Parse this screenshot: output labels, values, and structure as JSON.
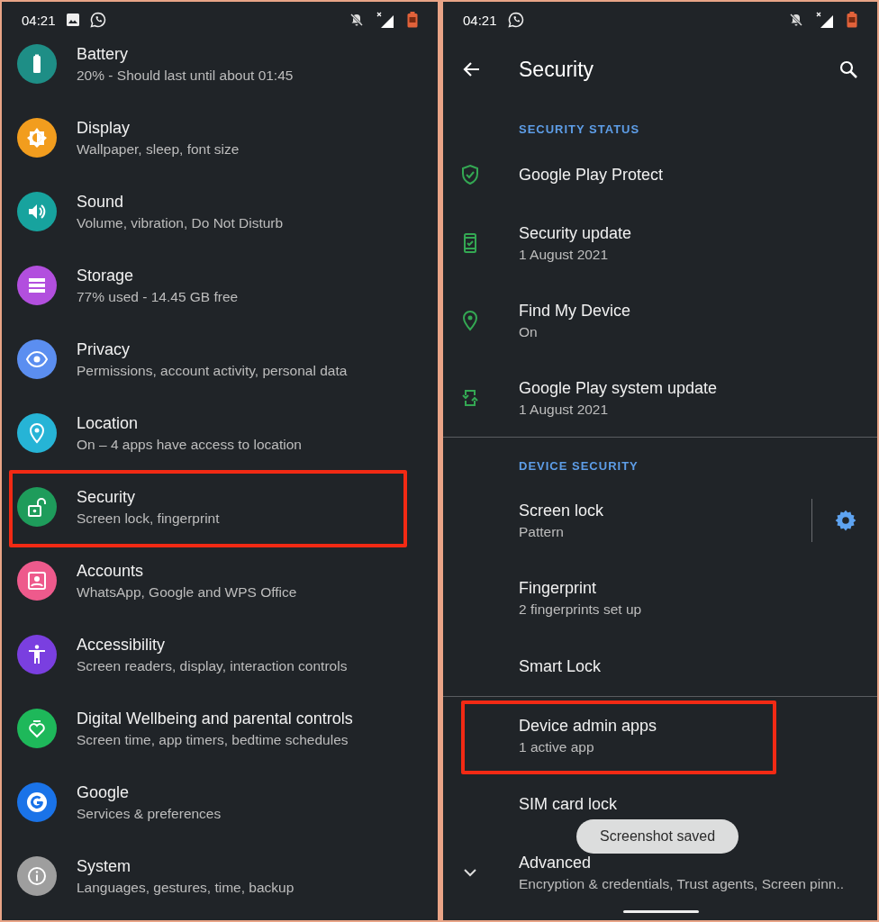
{
  "left_screen": {
    "status_bar": {
      "time": "04:21"
    },
    "settings": [
      {
        "title": "Battery",
        "subtitle": "20% - Should last until about 01:45",
        "color": "#1e8e86",
        "highlighted": false
      },
      {
        "title": "Display",
        "subtitle": "Wallpaper, sleep, font size",
        "color": "#f29d1e",
        "highlighted": false
      },
      {
        "title": "Sound",
        "subtitle": "Volume, vibration, Do Not Disturb",
        "color": "#17a39e",
        "highlighted": false
      },
      {
        "title": "Storage",
        "subtitle": "77% used - 14.45 GB free",
        "color": "#b24fde",
        "highlighted": false
      },
      {
        "title": "Privacy",
        "subtitle": "Permissions, account activity, personal data",
        "color": "#5b8ef0",
        "highlighted": false
      },
      {
        "title": "Location",
        "subtitle": "On – 4 apps have access to location",
        "color": "#26b4d6",
        "highlighted": false
      },
      {
        "title": "Security",
        "subtitle": "Screen lock, fingerprint",
        "color": "#1e9c5b",
        "highlighted": true
      },
      {
        "title": "Accounts",
        "subtitle": "WhatsApp, Google and WPS Office",
        "color": "#ee5a8c",
        "highlighted": false
      },
      {
        "title": "Accessibility",
        "subtitle": "Screen readers, display, interaction controls",
        "color": "#7a3fe0",
        "highlighted": false
      },
      {
        "title": "Digital Wellbeing and parental controls",
        "subtitle": "Screen time, app timers, bedtime schedules",
        "color": "#1eb85a",
        "highlighted": false
      },
      {
        "title": "Google",
        "subtitle": "Services & preferences",
        "color": "#1a73e8",
        "highlighted": false
      },
      {
        "title": "System",
        "subtitle": "Languages, gestures, time, backup",
        "color": "#9e9e9e",
        "highlighted": false
      }
    ]
  },
  "right_screen": {
    "status_bar": {
      "time": "04:21"
    },
    "app_bar": {
      "title": "Security"
    },
    "sections": [
      {
        "header": "SECURITY STATUS",
        "items": [
          {
            "title": "Google Play Protect",
            "highlighted": false
          },
          {
            "title": "Security update",
            "subtitle": "1 August 2021",
            "highlighted": false
          },
          {
            "title": "Find My Device",
            "subtitle": "On",
            "highlighted": false
          },
          {
            "title": "Google Play system update",
            "subtitle": "1 August 2021",
            "highlighted": false
          }
        ]
      },
      {
        "header": "DEVICE SECURITY",
        "items": [
          {
            "title": "Screen lock",
            "subtitle": "Pattern",
            "settings_button": true,
            "highlighted": false
          },
          {
            "title": "Fingerprint",
            "subtitle": "2 fingerprints set up",
            "highlighted": false
          },
          {
            "title": "Smart Lock",
            "highlighted": false
          }
        ]
      },
      {
        "items": [
          {
            "title": "Device admin apps",
            "subtitle": "1 active app",
            "highlighted": true
          },
          {
            "title": "SIM card lock",
            "highlighted": false
          },
          {
            "title": "Advanced",
            "subtitle": "Encryption & credentials, Trust agents, Screen pinn..",
            "expandable": true,
            "highlighted": false
          }
        ]
      }
    ],
    "toast": "Screenshot saved"
  }
}
